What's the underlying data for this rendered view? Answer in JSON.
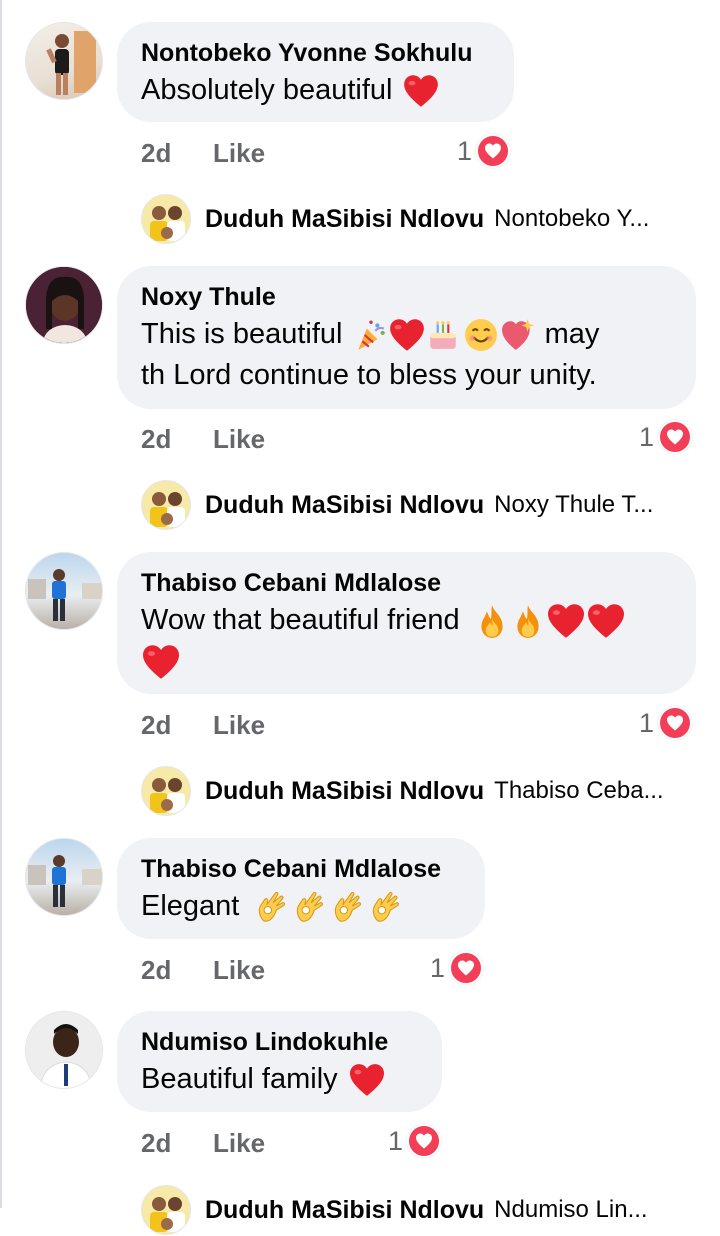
{
  "comments": [
    {
      "author": "Nontobeko Yvonne Sokhulu",
      "text": "Absolutely beautiful",
      "emojis": [
        "red-heart"
      ],
      "time": "2d",
      "like_label": "Like",
      "reaction_count": "1",
      "reply": {
        "author": "Duduh MaSibisi Ndlovu",
        "preview": "Nontobeko Y..."
      }
    },
    {
      "author": "Noxy Thule",
      "text_line1": "This is beautiful",
      "text_line1_emojis": [
        "party-popper",
        "red-heart",
        "birthday-cake",
        "smiling-face",
        "sparkling-heart"
      ],
      "text_line1_tail": "may",
      "text_line2": "th Lord continue to bless your unity.",
      "time": "2d",
      "like_label": "Like",
      "reaction_count": "1",
      "reply": {
        "author": "Duduh MaSibisi Ndlovu",
        "preview": "Noxy Thule T..."
      }
    },
    {
      "author": "Thabiso Cebani Mdlalose",
      "text": "Wow that beautiful friend",
      "emojis": [
        "fire",
        "fire",
        "red-heart",
        "red-heart",
        "red-heart"
      ],
      "time": "2d",
      "like_label": "Like",
      "reaction_count": "1",
      "reply": {
        "author": "Duduh MaSibisi Ndlovu",
        "preview": "Thabiso Ceba..."
      }
    },
    {
      "author": "Thabiso Cebani Mdlalose",
      "text": "Elegant",
      "emojis": [
        "ok-hand",
        "ok-hand",
        "ok-hand",
        "ok-hand"
      ],
      "time": "2d",
      "like_label": "Like",
      "reaction_count": "1"
    },
    {
      "author": "Ndumiso Lindokuhle",
      "text": "Beautiful family",
      "emojis": [
        "red-heart"
      ],
      "time": "2d",
      "like_label": "Like",
      "reaction_count": "1",
      "reply": {
        "author": "Duduh MaSibisi Ndlovu",
        "preview": "Ndumiso Lin..."
      }
    }
  ],
  "colors": {
    "bubble": "#f0f2f5",
    "meta_text": "#65676b",
    "love_reaction": "#f33e58",
    "text": "#050505"
  },
  "reaction_icon": "love-heart-icon"
}
